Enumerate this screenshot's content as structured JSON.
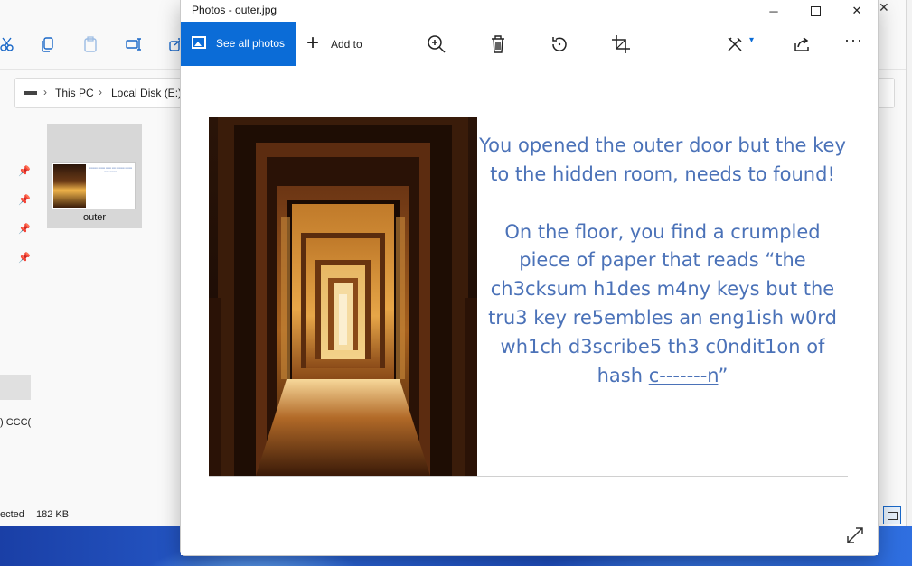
{
  "explorer": {
    "breadcrumb": [
      "This PC",
      "Local Disk (E:)"
    ],
    "file": {
      "name": "outer"
    },
    "nav_fragment": ") CCC(",
    "status": {
      "selected": "ected",
      "size": "182 KB"
    }
  },
  "photos": {
    "window_title": "Photos - outer.jpg",
    "toolbar": {
      "see_all_photos": "See all photos",
      "add_to": "Add to",
      "more": "···"
    },
    "image_text": {
      "para1": "You opened the outer door but the key to the hidden room, needs to found!",
      "para2_lead": "On the floor, you find a crumpled piece of paper that reads “the ch3cksum h1des m4ny keys but the tru3 key re5embles an eng1ish w0rd wh1ch d3scribe5 th3 c0ndit1on of hash ",
      "para2_blank": "c-------n",
      "para2_end": "”"
    }
  },
  "colors": {
    "accent": "#0b6cd7",
    "message_text": "#4b72b8"
  },
  "icons": [
    "cut-icon",
    "copy-icon",
    "paste-icon",
    "rename-icon",
    "share-icon",
    "pin-icon",
    "zoom-in-icon",
    "delete-icon",
    "rotate-icon",
    "crop-icon",
    "edit-icon",
    "chevron-down-icon",
    "share-icon",
    "more-icon",
    "expand-icon",
    "minimize-icon",
    "maximize-icon",
    "close-icon"
  ]
}
